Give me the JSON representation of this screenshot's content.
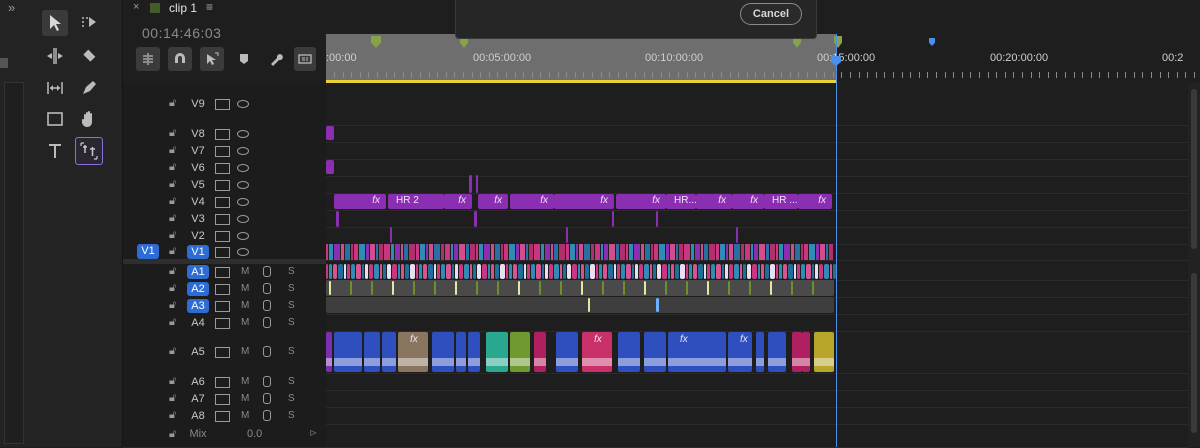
{
  "sequence": {
    "tab_name": "clip 1",
    "timecode": "00:14:46:03"
  },
  "dialog": {
    "cancel_label": "Cancel"
  },
  "ruler": {
    "labels": [
      ":00:00",
      "00:05:00:00",
      "00:10:00:00",
      "00:15:00:00",
      "00:20:00:00",
      "00:2"
    ]
  },
  "video_tracks": [
    {
      "name": "V9"
    },
    {
      "name": "V8"
    },
    {
      "name": "V7"
    },
    {
      "name": "V6"
    },
    {
      "name": "V5"
    },
    {
      "name": "V4"
    },
    {
      "name": "V3"
    },
    {
      "name": "V2"
    },
    {
      "name": "V1",
      "source": "V1"
    }
  ],
  "audio_tracks": [
    {
      "name": "A1",
      "mute": "M",
      "solo": "S"
    },
    {
      "name": "A2",
      "mute": "M",
      "solo": "S"
    },
    {
      "name": "A3",
      "mute": "M",
      "solo": "S"
    },
    {
      "name": "A4",
      "mute": "M",
      "solo": "S"
    },
    {
      "name": "A5",
      "mute": "M",
      "solo": "S"
    },
    {
      "name": "A6",
      "mute": "M",
      "solo": "S"
    },
    {
      "name": "A7",
      "mute": "M",
      "solo": "S"
    },
    {
      "name": "A8",
      "mute": "M",
      "solo": "S"
    }
  ],
  "mix": {
    "label": "Mix",
    "value": "0.0"
  },
  "v4_clip_labels": [
    "fx",
    "HR 2",
    "fx",
    "fx",
    "fx",
    "fx",
    "fx",
    "HR...",
    "fx",
    "fx",
    "HR ...",
    "fx"
  ],
  "a5_fx_label": "fx",
  "colors": {
    "accent": "#2d6cd4",
    "video_clip": "#8b2fb2",
    "playhead": "#4a90e8",
    "work_area": "#e8d238"
  }
}
